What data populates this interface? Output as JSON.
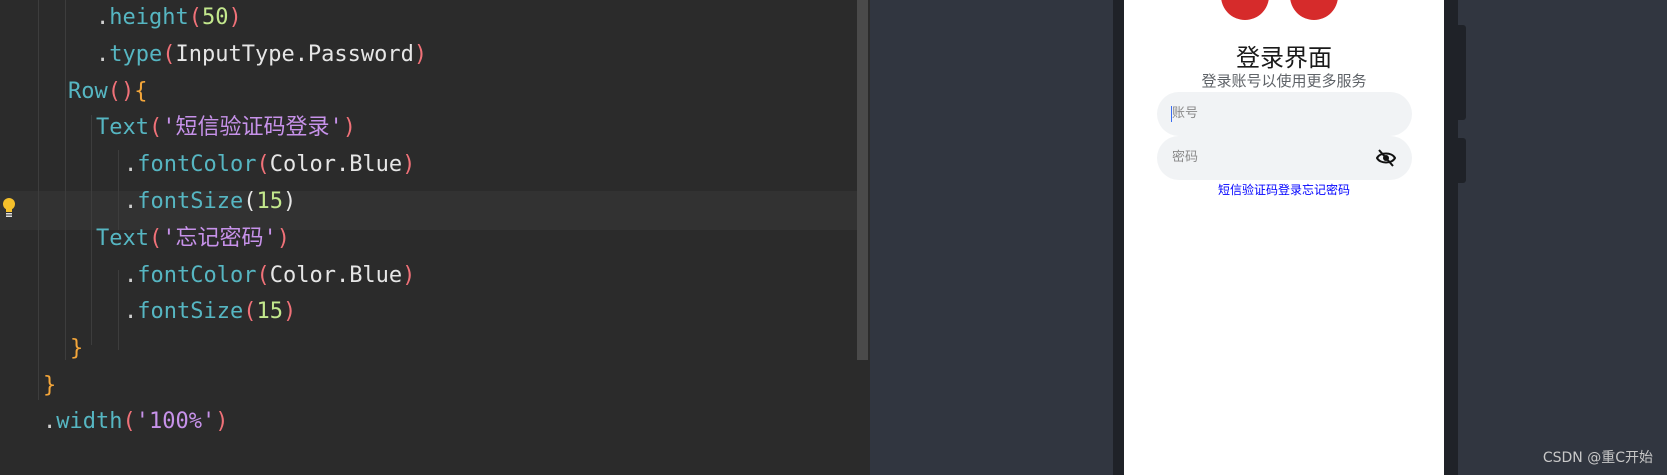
{
  "editor": {
    "lines": [
      {
        "t": [
          [
            ".",
            "punc"
          ],
          [
            "height",
            "method"
          ],
          [
            "(",
            "paren"
          ],
          [
            "50",
            "num"
          ],
          [
            ")",
            "paren"
          ]
        ]
      },
      {
        "t": [
          [
            ".",
            "punc"
          ],
          [
            "type",
            "method"
          ],
          [
            "(",
            "paren"
          ],
          [
            "InputType.Password",
            "plain"
          ],
          [
            ")",
            "paren"
          ]
        ]
      },
      {
        "t": [
          [
            "Row",
            "comp"
          ],
          [
            "()",
            "paren"
          ],
          [
            "{",
            "brace"
          ]
        ]
      },
      {
        "t": [
          [
            "Text",
            "comp"
          ],
          [
            "(",
            "paren"
          ],
          [
            "'短信验证码登录'",
            "str"
          ],
          [
            ")",
            "paren"
          ]
        ]
      },
      {
        "t": [
          [
            ".",
            "punc"
          ],
          [
            "fontColor",
            "method"
          ],
          [
            "(",
            "paren"
          ],
          [
            "Color.Blue",
            "plain"
          ],
          [
            ")",
            "paren"
          ]
        ]
      },
      {
        "t": [
          [
            ".",
            "punc"
          ],
          [
            "fontSize",
            "method"
          ],
          [
            "(",
            "match"
          ],
          [
            "15",
            "num"
          ],
          [
            ")",
            "match"
          ]
        ]
      },
      {
        "t": [
          [
            "Text",
            "comp"
          ],
          [
            "(",
            "paren"
          ],
          [
            "'忘记密码'",
            "str"
          ],
          [
            ")",
            "paren"
          ]
        ]
      },
      {
        "t": [
          [
            ".",
            "punc"
          ],
          [
            "fontColor",
            "method"
          ],
          [
            "(",
            "paren"
          ],
          [
            "Color.Blue",
            "plain"
          ],
          [
            ")",
            "paren"
          ]
        ]
      },
      {
        "t": [
          [
            ".",
            "punc"
          ],
          [
            "fontSize",
            "method"
          ],
          [
            "(",
            "paren"
          ],
          [
            "15",
            "num"
          ],
          [
            ")",
            "paren"
          ]
        ]
      },
      {
        "t": [
          [
            "}",
            "brace"
          ]
        ]
      },
      {
        "t": [
          [
            "}",
            "brace"
          ]
        ]
      },
      {
        "t": [
          [
            ".",
            "punc"
          ],
          [
            "width",
            "method"
          ],
          [
            "(",
            "paren"
          ],
          [
            "'100%'",
            "str"
          ],
          [
            ")",
            "paren"
          ]
        ]
      }
    ]
  },
  "preview": {
    "title": "登录界面",
    "subtitle": "登录账号以使用更多服务",
    "account_placeholder": "账号",
    "password_placeholder": "密码",
    "sms_login_link": "短信验证码登录",
    "forgot_password_link": "忘记密码",
    "link_color": "#0000ff"
  },
  "watermark": "CSDN @重C开始",
  "colors": {
    "editor_bg": "#2b2b2b",
    "preview_bg": "#313640",
    "logo_red": "#d62b2b"
  }
}
